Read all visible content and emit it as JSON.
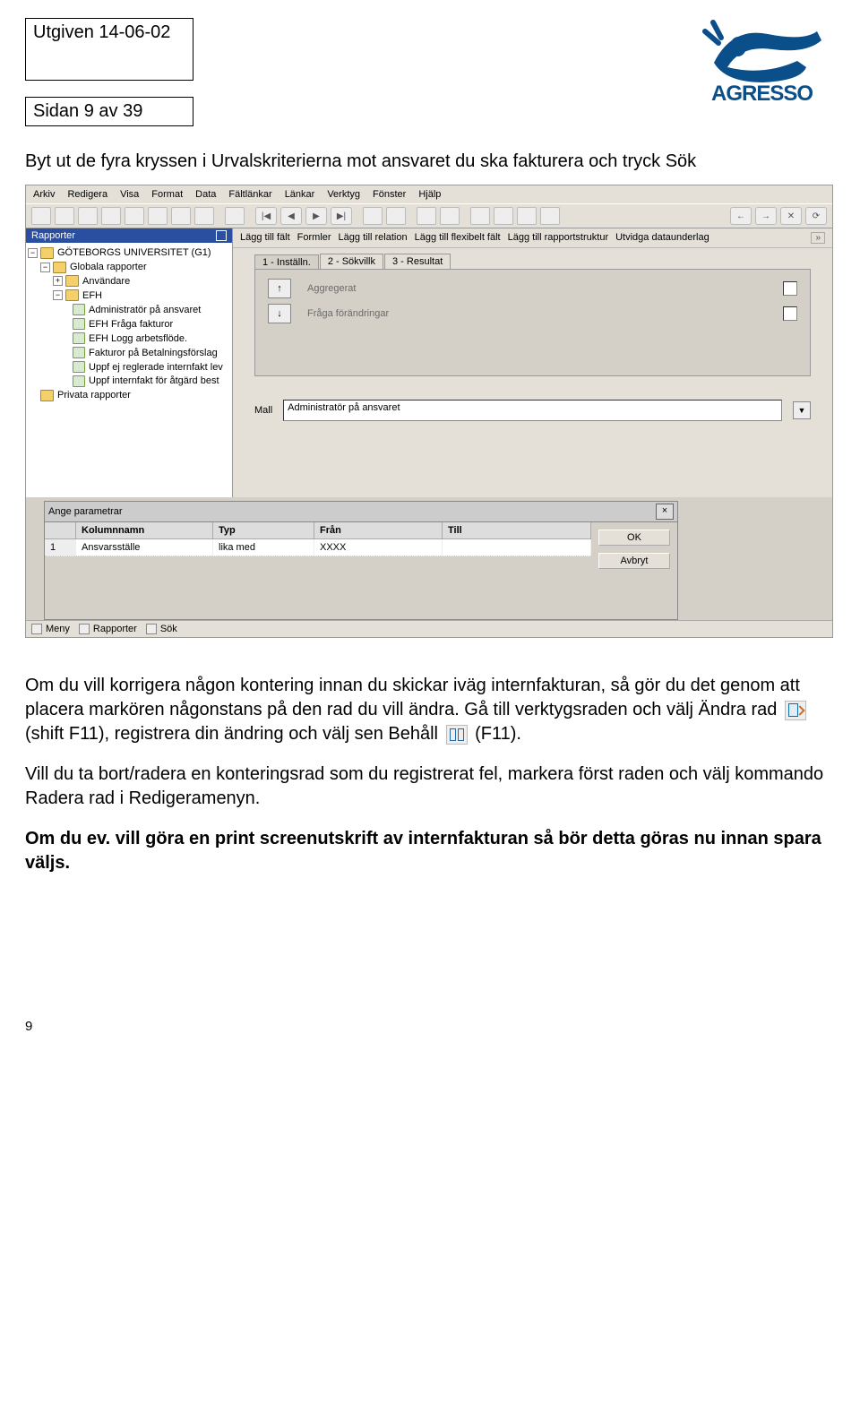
{
  "header": {
    "issued": "Utgiven 14-06-02",
    "pageof": "Sidan 9 av 39",
    "logo_text": "AGRESSO"
  },
  "intro": "Byt ut de fyra kryssen i Urvalskriterierna mot ansvaret du ska fakturera och tryck Sök",
  "menus": [
    "Arkiv",
    "Redigera",
    "Visa",
    "Format",
    "Data",
    "Fältlänkar",
    "Länkar",
    "Verktyg",
    "Fönster",
    "Hjälp"
  ],
  "sidebar": {
    "title": "Rapporter",
    "root": "GÖTEBORGS UNIVERSITET (G1)",
    "globala": "Globala rapporter",
    "anvandare": "Användare",
    "efh": "EFH",
    "items": [
      "Administratör på ansvaret",
      "EFH Fråga fakturor",
      "EFH Logg arbetsflöde.",
      "Fakturor på Betalningsförslag",
      "Uppf ej reglerade internfakt lev",
      "Uppf internfakt för åtgärd best"
    ],
    "privata": "Privata rapporter"
  },
  "toolstrip": [
    "Lägg till fält",
    "Formler",
    "Lägg till relation",
    "Lägg till flexibelt fält",
    "Lägg till rapportstruktur",
    "Utvidga dataunderlag"
  ],
  "tabs": [
    "1 - Inställn.",
    "2 - Sökvillk",
    "3 - Resultat"
  ],
  "options": {
    "aggregerat": "Aggregerat",
    "fraga": "Fråga förändringar"
  },
  "mall_label": "Mall",
  "mall_value": "Administratör på ansvaret",
  "param": {
    "title": "Ange parametrar",
    "headers": {
      "col": "Kolumnnamn",
      "typ": "Typ",
      "fran": "Från",
      "till": "Till"
    },
    "row": {
      "n": "1",
      "col": "Ansvarsställe",
      "typ": "lika med",
      "fran": "XXXX",
      "till": ""
    },
    "ok": "OK",
    "cancel": "Avbryt"
  },
  "bottom_tabs": [
    "Meny",
    "Rapporter",
    "Sök"
  ],
  "body": {
    "p1a": "Om du vill korrigera någon kontering innan du skickar iväg internfakturan, så gör du det genom att placera markören någonstans på den rad du vill ändra. Gå till verktygsraden och välj Ändra rad ",
    "p1b": " (shift F11), registrera din ändring och välj sen Behåll ",
    "p1c": " (F11).",
    "p2": "Vill du ta bort/radera en konteringsrad som du registrerat fel, markera först raden och välj kommando Radera rad i Redigeramenyn.",
    "p3": "Om du ev. vill göra en print screenutskrift av internfakturan så bör detta göras nu innan spara väljs."
  },
  "footer_num": "9"
}
